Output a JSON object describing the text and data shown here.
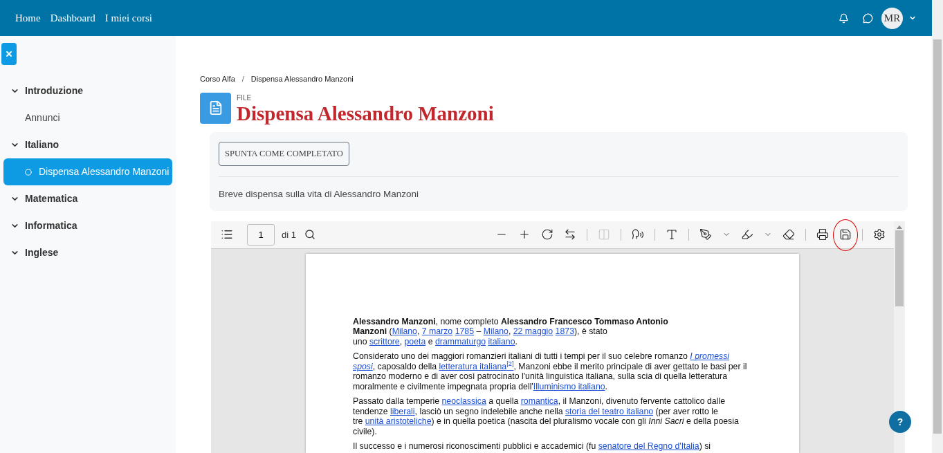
{
  "navbar": {
    "links": [
      "Home",
      "Dashboard",
      "I miei corsi"
    ],
    "avatar": "MR"
  },
  "sidebar": {
    "items": [
      {
        "label": "Introduzione",
        "expanded": true,
        "children": [
          {
            "label": "Annunci",
            "selected": false
          }
        ]
      },
      {
        "label": "Italiano",
        "expanded": true,
        "children": [
          {
            "label": "Dispensa Alessandro Manzoni",
            "selected": true
          }
        ]
      },
      {
        "label": "Matematica",
        "expanded": true
      },
      {
        "label": "Informatica",
        "expanded": true
      },
      {
        "label": "Inglese",
        "expanded": true
      }
    ]
  },
  "breadcrumb": {
    "separator": "/",
    "items": [
      "Corso Alfa",
      "Dispensa Alessandro Manzoni"
    ]
  },
  "header": {
    "type_label": "FILE",
    "title": "Dispensa Alessandro Manzoni"
  },
  "activity": {
    "button": "SPUNTA COME COMPLETATO",
    "description": "Breve dispensa sulla vita di Alessandro Manzoni"
  },
  "viewer": {
    "page_input": "1",
    "page_count": "di 1",
    "tool_groups": [
      [
        {
          "kind": "zoom-out",
          "disabled": false,
          "circled": false
        },
        {
          "kind": "zoom-in",
          "disabled": false,
          "circled": false
        },
        {
          "kind": "rotate",
          "disabled": false,
          "circled": false
        },
        {
          "kind": "fit-width",
          "disabled": false,
          "circled": false
        }
      ],
      [
        {
          "kind": "two-page",
          "disabled": true,
          "circled": false
        }
      ],
      [
        {
          "kind": "read-aloud",
          "disabled": false,
          "circled": false
        }
      ],
      [
        {
          "kind": "text-box",
          "disabled": false,
          "circled": false
        }
      ],
      [
        {
          "kind": "draw",
          "disabled": false,
          "circled": false
        },
        {
          "kind": "dropdown",
          "disabled": false,
          "circled": false
        },
        {
          "kind": "highlight",
          "disabled": false,
          "circled": false
        },
        {
          "kind": "dropdown",
          "disabled": false,
          "circled": false
        },
        {
          "kind": "erase",
          "disabled": false,
          "circled": false
        }
      ],
      [
        {
          "kind": "print",
          "disabled": false,
          "circled": false
        },
        {
          "kind": "save",
          "disabled": false,
          "circled": true
        }
      ],
      [
        {
          "kind": "settings",
          "disabled": false,
          "circled": false
        }
      ]
    ],
    "paragraphs": [
      [
        {
          "kind": "bold",
          "text": "Alessandro Manzoni"
        },
        {
          "kind": "plain",
          "text": ", nome completo "
        },
        {
          "kind": "bold",
          "text": "Alessandro Francesco Tommaso Antonio"
        },
        {
          "kind": "break"
        },
        {
          "kind": "bold",
          "text": "Manzoni"
        },
        {
          "kind": "plain",
          "text": " ("
        },
        {
          "kind": "link",
          "text": "Milano"
        },
        {
          "kind": "plain",
          "text": ", "
        },
        {
          "kind": "link",
          "text": "7 marzo"
        },
        {
          "kind": "space"
        },
        {
          "kind": "link",
          "text": "1785"
        },
        {
          "kind": "plain",
          "text": " – "
        },
        {
          "kind": "link",
          "text": "Milano"
        },
        {
          "kind": "plain",
          "text": ", "
        },
        {
          "kind": "link",
          "text": "22 maggio"
        },
        {
          "kind": "space"
        },
        {
          "kind": "link",
          "text": "1873"
        },
        {
          "kind": "plain",
          "text": "), è stato"
        },
        {
          "kind": "break"
        },
        {
          "kind": "plain",
          "text": "uno "
        },
        {
          "kind": "link",
          "text": "scrittore"
        },
        {
          "kind": "plain",
          "text": ", "
        },
        {
          "kind": "link",
          "text": "poeta"
        },
        {
          "kind": "plain",
          "text": " e "
        },
        {
          "kind": "link",
          "text": "drammaturgo"
        },
        {
          "kind": "space"
        },
        {
          "kind": "link",
          "text": "italiano"
        },
        {
          "kind": "plain",
          "text": "."
        }
      ],
      [
        {
          "kind": "plain",
          "text": "Considerato uno dei maggiori romanzieri italiani di tutti i tempi per il suo celebre romanzo "
        },
        {
          "kind": "italic-link",
          "text": "I promessi"
        },
        {
          "kind": "space"
        },
        {
          "kind": "italic-link",
          "text": "sposi"
        },
        {
          "kind": "plain",
          "text": ", caposaldo della "
        },
        {
          "kind": "link",
          "text": "letteratura italiana$^{[2]}$"
        },
        {
          "kind": "plain",
          "text": ", Manzoni ebbe il merito principale di aver gettato le basi per il romanzo moderno e di aver così patrocinato l'unità linguistica italiana, sulla scia di quella letteratura moralmente e civilmente impegnata propria dell'"
        },
        {
          "kind": "link",
          "text": "Illuminismo italiano"
        },
        {
          "kind": "plain",
          "text": "."
        }
      ],
      [
        {
          "kind": "plain",
          "text": "Passato dalla temperie "
        },
        {
          "kind": "link",
          "text": "neoclassica"
        },
        {
          "kind": "plain",
          "text": " a quella "
        },
        {
          "kind": "link",
          "text": "romantica"
        },
        {
          "kind": "plain",
          "text": ", il Manzoni, divenuto fervente cattolico dalle tendenze "
        },
        {
          "kind": "link",
          "text": "liberali"
        },
        {
          "kind": "plain",
          "text": ", lasciò un segno indelebile anche nella "
        },
        {
          "kind": "link",
          "text": "storia del teatro italiano"
        },
        {
          "kind": "plain",
          "text": " (per aver rotto le"
        },
        {
          "kind": "break"
        },
        {
          "kind": "plain",
          "text": "tre "
        },
        {
          "kind": "link",
          "text": "unità aristoteliche"
        },
        {
          "kind": "plain",
          "text": ") e in quella poetica (nascita del pluralismo vocale con gli "
        },
        {
          "kind": "italic",
          "text": "Inni Sacri"
        },
        {
          "kind": "plain",
          "text": " e della poesia civile)."
        }
      ],
      [
        {
          "kind": "plain",
          "text": "Il successo e i numerosi riconoscimenti pubblici e accademici (fu "
        },
        {
          "kind": "link",
          "text": "senatore del Regno d'Italia"
        },
        {
          "kind": "plain",
          "text": ") si"
        }
      ]
    ]
  },
  "help_button": "?"
}
